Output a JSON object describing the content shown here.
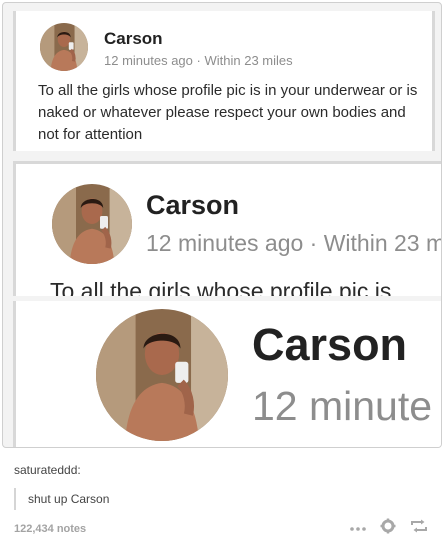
{
  "post": {
    "panels": [
      {
        "name": "Carson",
        "time": "12 minutes ago",
        "separator": "·",
        "distance": "Within 23 miles",
        "body": "To all the girls whose profile pic is in your underwear or is naked or whatever please respect your own bodies and not for attention"
      },
      {
        "name": "Carson",
        "meta": "12 minutes ago · Within 23 m",
        "body": "To all the girls whose profile pic is"
      },
      {
        "name": "Carson",
        "meta": "12 minute"
      }
    ]
  },
  "reblog": {
    "username": "saturateddd:",
    "comment": "shut up Carson"
  },
  "footer": {
    "notes": "122,434 notes",
    "icons": [
      "more-dots-icon",
      "gear-icon",
      "reblog-icon"
    ]
  }
}
